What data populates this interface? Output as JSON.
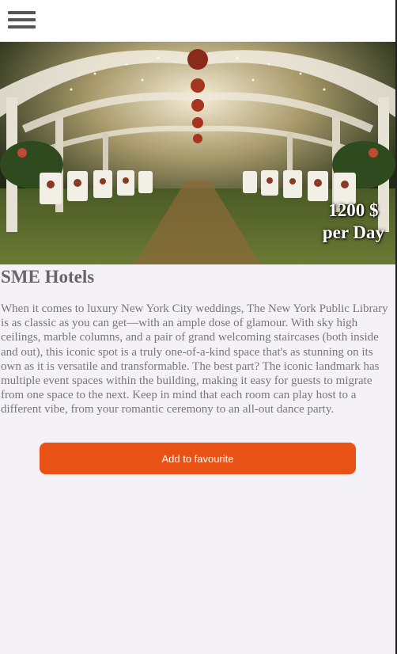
{
  "header": {
    "menu_icon": "hamburger-menu-icon"
  },
  "hero": {
    "image_description_icon": "wedding-venue-photo",
    "price_line1": "1200 $",
    "price_line2": "per Day"
  },
  "venue": {
    "name": "SME Hotels",
    "description": "When it comes to luxury New York City weddings, The New York Public Library is as classic as you can get—with an ample dose of glamour. With sky high ceilings, marble columns, and a pair of grand welcoming staircases (both inside and out), this iconic spot is a truly one-of-a-kind space that's as stunning on its own as it is versatile and transformable. The best part? The iconic landmark has multiple event spaces within the building, making it easy for guests to migrate from one space to the next. Keep in mind that each room can play host to a different vibe, from your romantic ceremony to an all-out dance party."
  },
  "actions": {
    "favourite_label": "Add to favourite"
  },
  "colors": {
    "accent": "#e85214",
    "background": "#f4f2f7"
  }
}
